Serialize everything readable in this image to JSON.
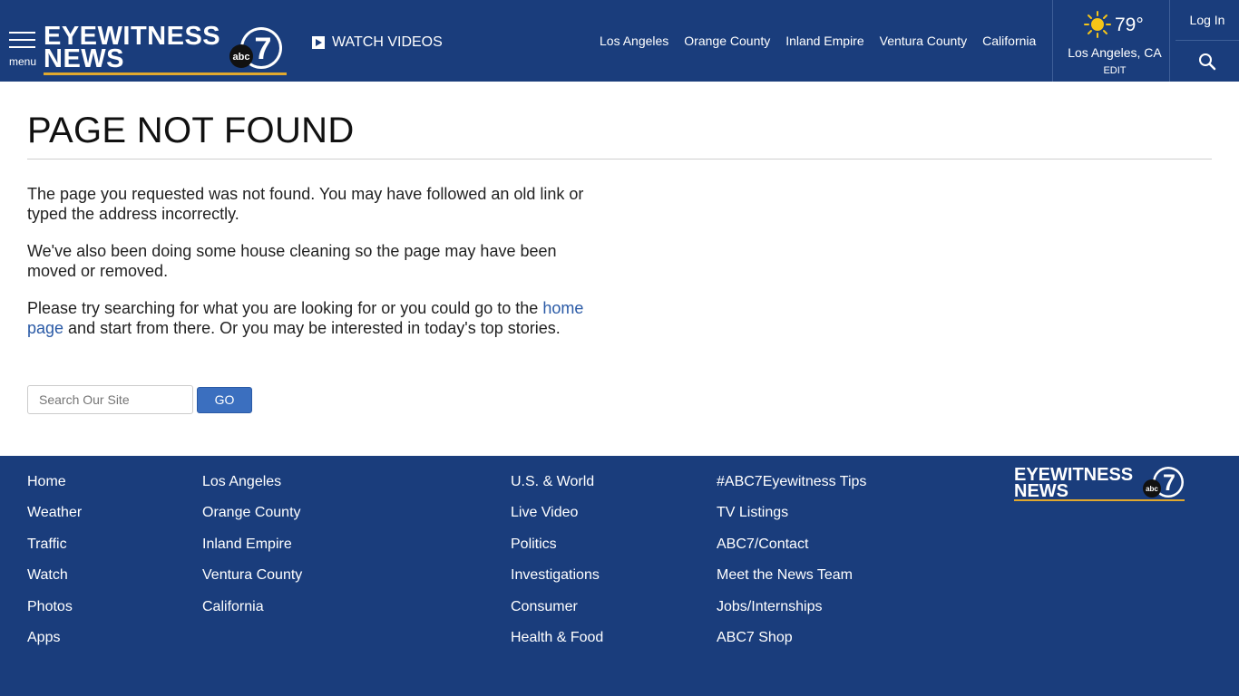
{
  "header": {
    "menu_label": "menu",
    "logo_line1": "EYEWITNESS",
    "logo_line2": "NEWS",
    "logo_badge": "abc",
    "logo_number": "7",
    "watch_label": "WATCH VIDEOS",
    "nav": [
      "Los Angeles",
      "Orange County",
      "Inland Empire",
      "Ventura County",
      "California"
    ],
    "weather": {
      "temp": "79°",
      "location": "Los Angeles, CA",
      "edit": "EDIT"
    },
    "login": "Log In"
  },
  "main": {
    "title": "PAGE NOT FOUND",
    "para1": "The page you requested was not found. You may have followed an old link or typed the address incorrectly.",
    "para2": "We've also been doing some house cleaning so the page may have been moved or removed.",
    "para3_before": "Please try searching for what you are looking for or you could go to the ",
    "para3_link": "home page",
    "para3_after": " and start from there. Or you may be interested in today's top stories.",
    "search_placeholder": "Search Our Site",
    "go_label": "GO"
  },
  "footer": {
    "col1": [
      "Home",
      "Weather",
      "Traffic",
      "Watch",
      "Photos",
      "Apps"
    ],
    "col2": [
      "Los Angeles",
      "Orange County",
      "Inland Empire",
      "Ventura County",
      "California"
    ],
    "col3": [
      "U.S. & World",
      "Live Video",
      "Politics",
      "Investigations",
      "Consumer",
      "Health & Food"
    ],
    "col4": [
      "#ABC7Eyewitness Tips",
      "TV Listings",
      "ABC7/Contact",
      "Meet the News Team",
      "Jobs/Internships",
      "ABC7 Shop"
    ],
    "logo_line1": "EYEWITNESS",
    "logo_line2": "NEWS"
  },
  "colors": {
    "brand_blue": "#1a3d7c",
    "accent_gold": "#e0a82e",
    "link_blue": "#2a5aa6",
    "button_blue": "#3b6fbf"
  }
}
